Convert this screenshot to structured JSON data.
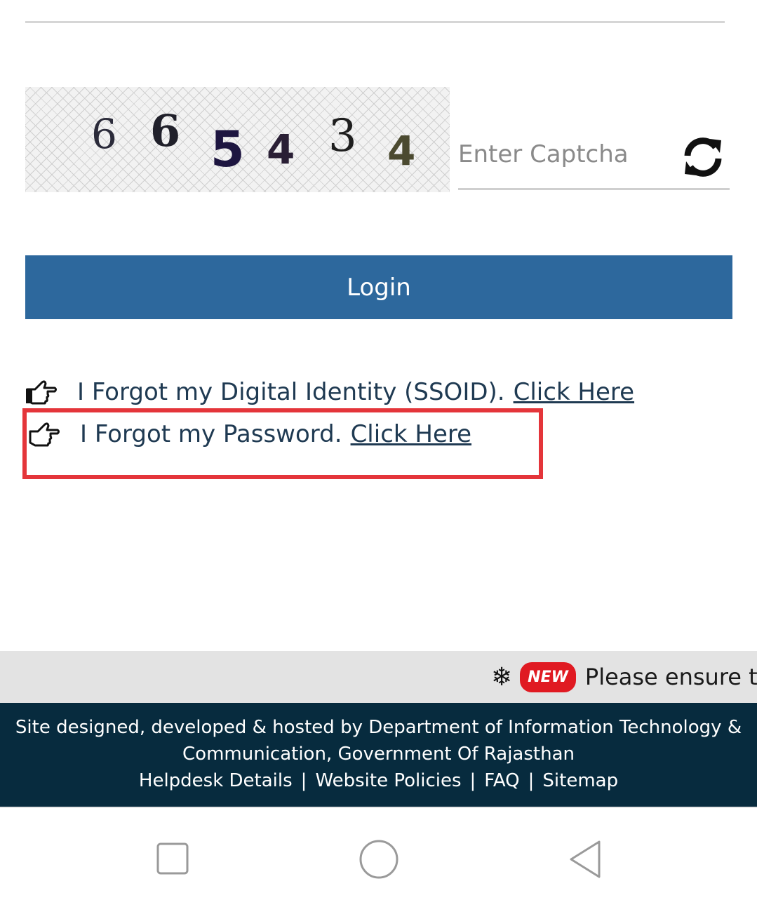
{
  "captcha": {
    "digits": [
      "6",
      "6",
      "5",
      "4",
      "3",
      "4"
    ],
    "input_placeholder": "Enter Captcha",
    "input_value": "",
    "refresh_icon": "refresh-icon"
  },
  "login": {
    "button_label": "Login",
    "button_color": "#2d689d"
  },
  "links": {
    "forgot_ssoid_text": "I Forgot my Digital Identity (SSOID).",
    "forgot_ssoid_link": "Click Here",
    "forgot_password_text": "I Forgot my Password.",
    "forgot_password_link": "Click Here",
    "icon": "pointing-hand-icon"
  },
  "highlight": {
    "color": "#e4353a"
  },
  "ticker": {
    "icon": "snowflake-icon",
    "badge": "NEW",
    "text": "Please ensure th"
  },
  "footer": {
    "line1": "Site designed, developed & hosted by Department of Information Technology &",
    "line2": "Communication, Government Of Rajasthan",
    "links": [
      "Helpdesk Details",
      "Website Policies",
      "FAQ",
      "Sitemap"
    ],
    "background": "#072b3e"
  },
  "navbar": {
    "buttons": [
      "recent-apps",
      "home",
      "back"
    ]
  }
}
